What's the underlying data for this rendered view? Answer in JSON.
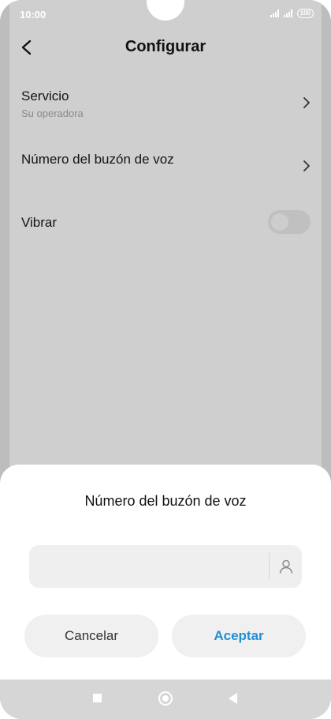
{
  "status_bar": {
    "time": "10:00",
    "battery": "100"
  },
  "header": {
    "title": "Configurar"
  },
  "settings": {
    "service": {
      "title": "Servicio",
      "subtitle": "Su operadora"
    },
    "voicemail_number": {
      "title": "Número del buzón de voz"
    },
    "vibrate": {
      "title": "Vibrar",
      "enabled": false
    }
  },
  "dialog": {
    "title": "Número del buzón de voz",
    "input_value": "",
    "cancel_label": "Cancelar",
    "accept_label": "Aceptar"
  },
  "colors": {
    "accent": "#1f8fd6",
    "overlay": "#cfcfcf"
  },
  "icons": [
    "back-arrow-icon",
    "chevron-right-icon",
    "contact-icon",
    "nav-recents-icon",
    "nav-home-icon",
    "nav-back-icon"
  ]
}
